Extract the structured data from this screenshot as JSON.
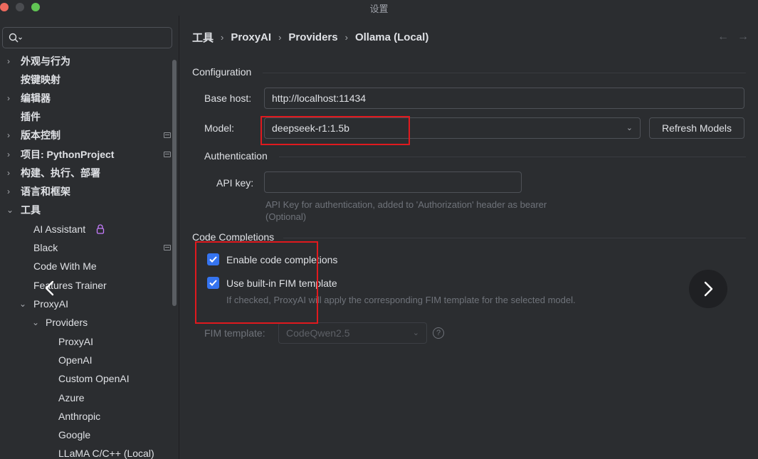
{
  "window": {
    "title": "设置"
  },
  "sidebar": {
    "search_placeholder": "",
    "items": [
      {
        "label": "外观与行为",
        "expandable": true
      },
      {
        "label": "按键映射",
        "expandable": false
      },
      {
        "label": "编辑器",
        "expandable": true
      },
      {
        "label": "插件",
        "expandable": false
      },
      {
        "label": "版本控制",
        "expandable": true
      },
      {
        "label": "项目: PythonProject",
        "expandable": true
      },
      {
        "label": "构建、执行、部署",
        "expandable": true
      },
      {
        "label": "语言和框架",
        "expandable": true
      },
      {
        "label": "工具",
        "expandable": true,
        "expanded": true
      },
      {
        "label": "AI Assistant"
      },
      {
        "label": "Black"
      },
      {
        "label": "Code With Me"
      },
      {
        "label": "Features Trainer"
      },
      {
        "label": "ProxyAI",
        "expanded": true
      },
      {
        "label": "Providers",
        "expanded": true
      },
      {
        "label": "ProxyAI"
      },
      {
        "label": "OpenAI"
      },
      {
        "label": "Custom OpenAI"
      },
      {
        "label": "Azure"
      },
      {
        "label": "Anthropic"
      },
      {
        "label": "Google"
      },
      {
        "label": "LLaMA C/C++ (Local)"
      }
    ]
  },
  "breadcrumb": [
    "工具",
    "ProxyAI",
    "Providers",
    "Ollama (Local)"
  ],
  "config": {
    "title": "Configuration",
    "base_host_label": "Base host:",
    "base_host_value": "http://localhost:11434",
    "model_label": "Model:",
    "model_value": "deepseek-r1:1.5b",
    "refresh_button": "Refresh Models"
  },
  "auth": {
    "title": "Authentication",
    "api_key_label": "API key:",
    "api_key_value": "",
    "help": "API Key for authentication, added to 'Authorization' header as bearer (Optional)"
  },
  "completions": {
    "title": "Code Completions",
    "enable_label": "Enable code completions",
    "enable_checked": true,
    "fim_builtin_label": "Use built-in FIM template",
    "fim_builtin_checked": true,
    "fim_help": "If checked, ProxyAI will apply the corresponding FIM template for the selected model.",
    "fim_template_label": "FIM template:",
    "fim_template_value": "CodeQwen2.5"
  },
  "colors": {
    "accent": "#3574f0",
    "highlight_box": "#e0191e",
    "lock": "#c77dff"
  }
}
